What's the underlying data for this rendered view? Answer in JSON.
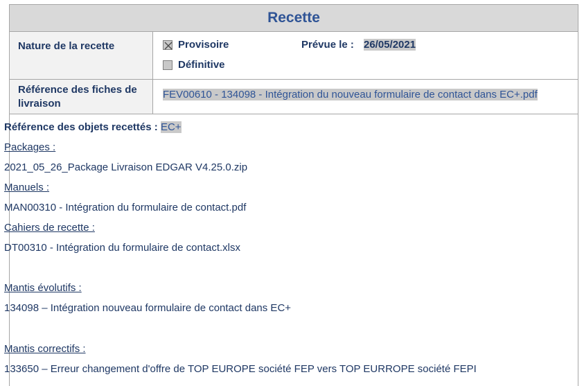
{
  "header": {
    "title": "Recette"
  },
  "nature": {
    "label": "Nature de la recette",
    "provisoire": {
      "label": "Provisoire",
      "checked": true
    },
    "definitive": {
      "label": "Définitive",
      "checked": false
    },
    "prevue_label": "Prévue le :",
    "prevue_date": "26/05/2021"
  },
  "fiches": {
    "label": "Référence des fiches de livraison",
    "value": "FEV00610 - 134098 - Intégration du nouveau formulaire de contact dans EC+.pdf"
  },
  "objets": {
    "label": "Référence des objets recettés :",
    "value": "EC+",
    "packages_label": "Packages :",
    "packages_value": "2021_05_26_Package Livraison EDGAR V4.25.0.zip",
    "manuels_label": "Manuels :",
    "manuels_value": "MAN00310 - Intégration du formulaire de contact.pdf",
    "cahiers_label": "Cahiers de recette :",
    "cahiers_value": "DT00310 - Intégration du formulaire de contact.xlsx",
    "evolutifs_label": "Mantis évolutifs :",
    "evolutifs_value": "134098 – Intégration nouveau formulaire de contact dans EC+",
    "correctifs_label": "Mantis correctifs :",
    "correctifs_value": "133650 – Erreur changement d'offre de TOP EUROPE société FEP vers TOP EURROPE société FEPI"
  }
}
